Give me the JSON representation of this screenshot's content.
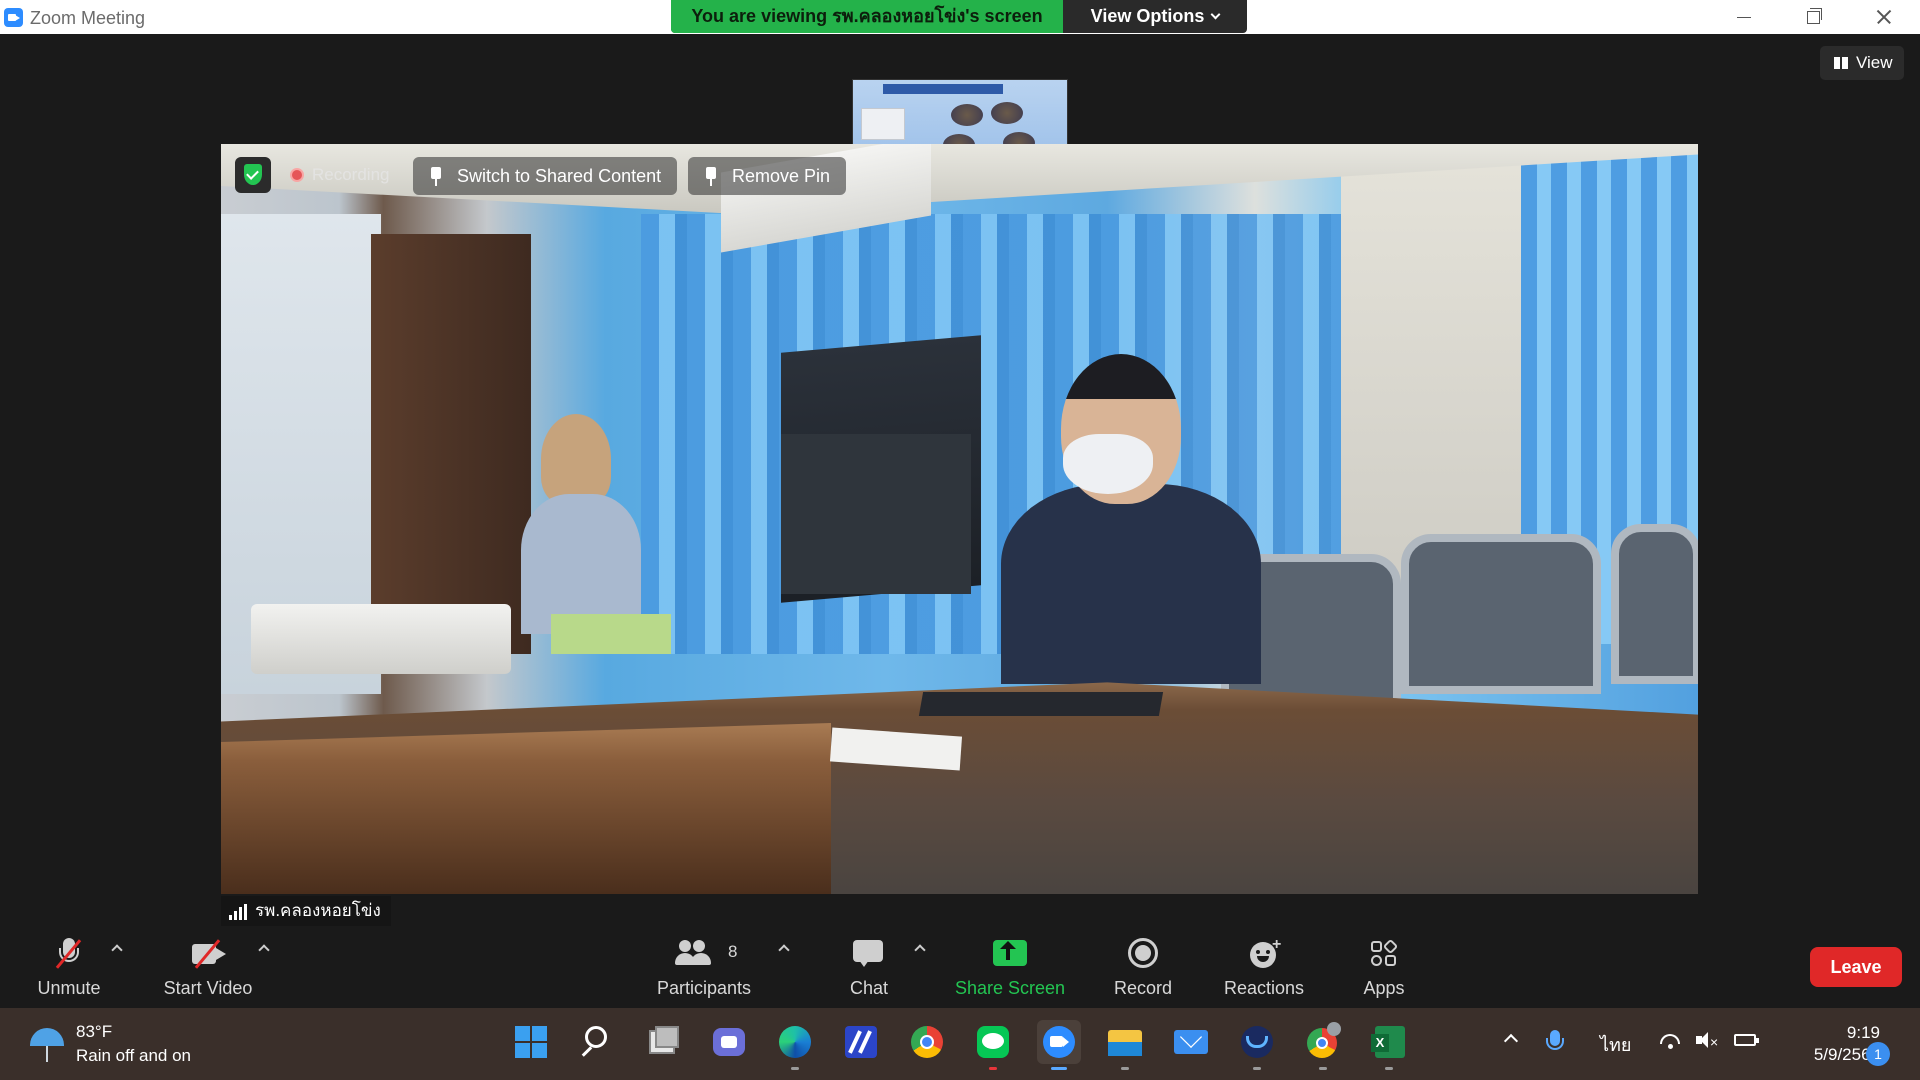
{
  "window": {
    "title": "Zoom Meeting"
  },
  "banner": {
    "viewing_text": "You are viewing รพ.คลองหอยโข่ง's screen",
    "view_options_label": "View Options"
  },
  "top_right": {
    "view_label": "View"
  },
  "video": {
    "recording_label": "Recording",
    "switch_label": "Switch to Shared Content",
    "remove_pin_label": "Remove Pin",
    "participant_name": "รพ.คลองหอยโข่ง"
  },
  "toolbar": {
    "unmute_label": "Unmute",
    "start_video_label": "Start Video",
    "participants_label": "Participants",
    "participants_count": "8",
    "chat_label": "Chat",
    "share_screen_label": "Share Screen",
    "record_label": "Record",
    "reactions_label": "Reactions",
    "apps_label": "Apps",
    "leave_label": "Leave"
  },
  "colors": {
    "share_green": "#23c552",
    "leave_red": "#e02828",
    "accent_blue": "#2d8cff"
  },
  "taskbar": {
    "weather_temp": "83°F",
    "weather_desc": "Rain off and on",
    "icons": [
      "start-icon",
      "search-icon",
      "task-view-icon",
      "teams-chat-icon",
      "edge-icon",
      "visual-studio-icon",
      "chrome-icon",
      "line-icon",
      "zoom-icon",
      "file-explorer-icon",
      "mail-icon",
      "webex-icon",
      "chrome-profile-icon",
      "excel-icon"
    ],
    "language": "ไทย",
    "time": "9:19",
    "date": "5/9/2565",
    "notification_count": "1"
  }
}
